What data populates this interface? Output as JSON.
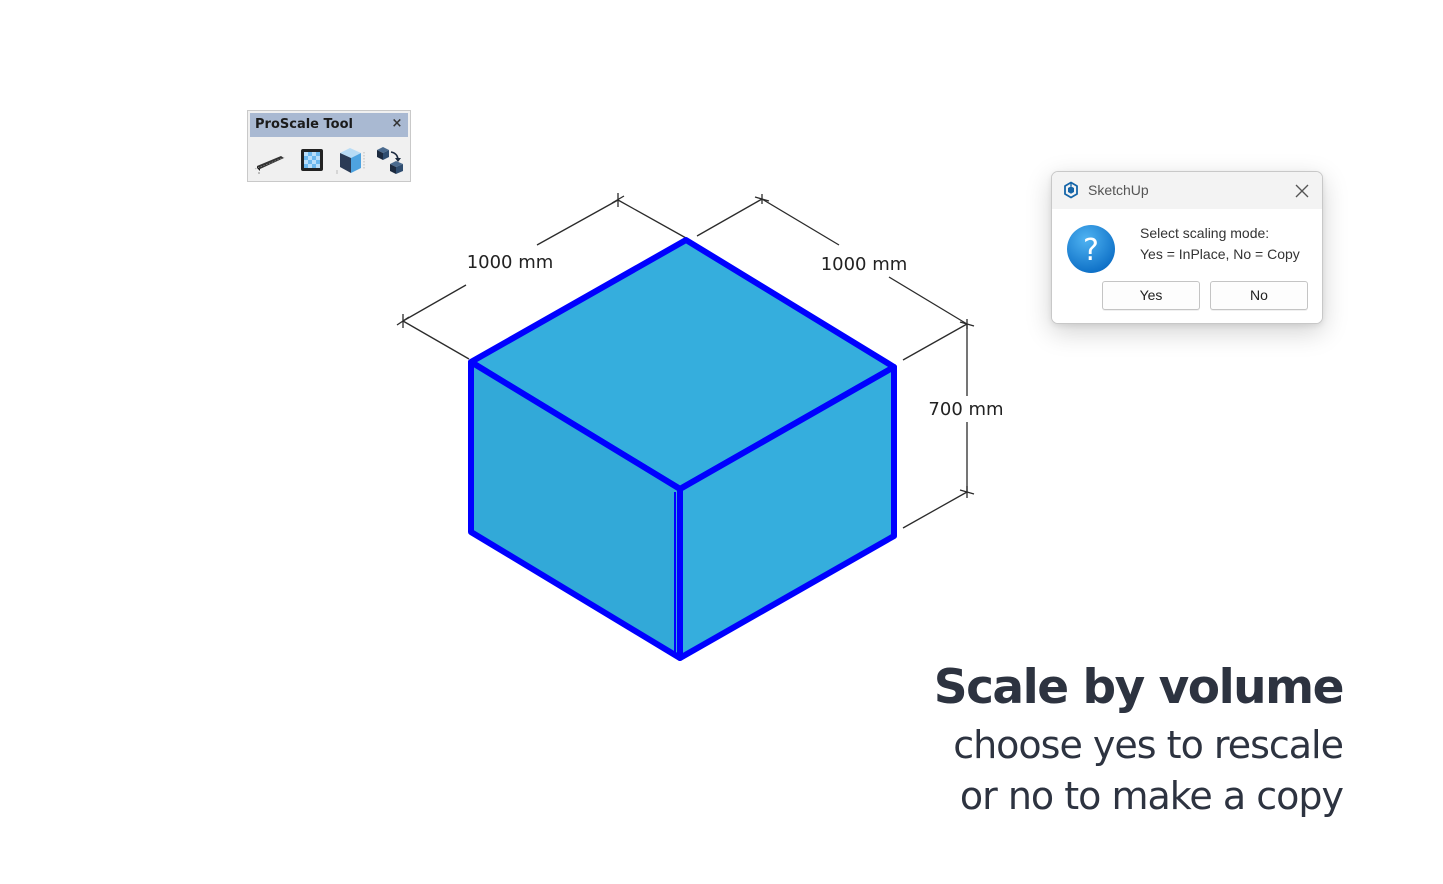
{
  "toolbar": {
    "title": "ProScale Tool",
    "close_glyph": "×",
    "tools": [
      {
        "icon": "linear-scale-icon"
      },
      {
        "icon": "area-scale-icon"
      },
      {
        "icon": "volume-scale-icon"
      },
      {
        "icon": "copy-scale-icon"
      }
    ]
  },
  "model": {
    "dimensions": {
      "left_width": "1000 mm",
      "right_depth": "1000 mm",
      "height": "700 mm"
    },
    "colors": {
      "face": "#35aedd",
      "face_dark": "#31a9d8",
      "edge": "#0000ff",
      "dim_line": "#2b2b2b"
    }
  },
  "dialog": {
    "app_name": "SketchUp",
    "icon": "question-icon",
    "message_line1": "Select scaling mode:",
    "message_line2": "Yes = InPlace, No = Copy",
    "yes_label": "Yes",
    "no_label": "No",
    "accent": "#1e88d6"
  },
  "caption": {
    "heading": "Scale by volume",
    "line1": "choose yes to rescale",
    "line2": "or no to make a copy"
  }
}
